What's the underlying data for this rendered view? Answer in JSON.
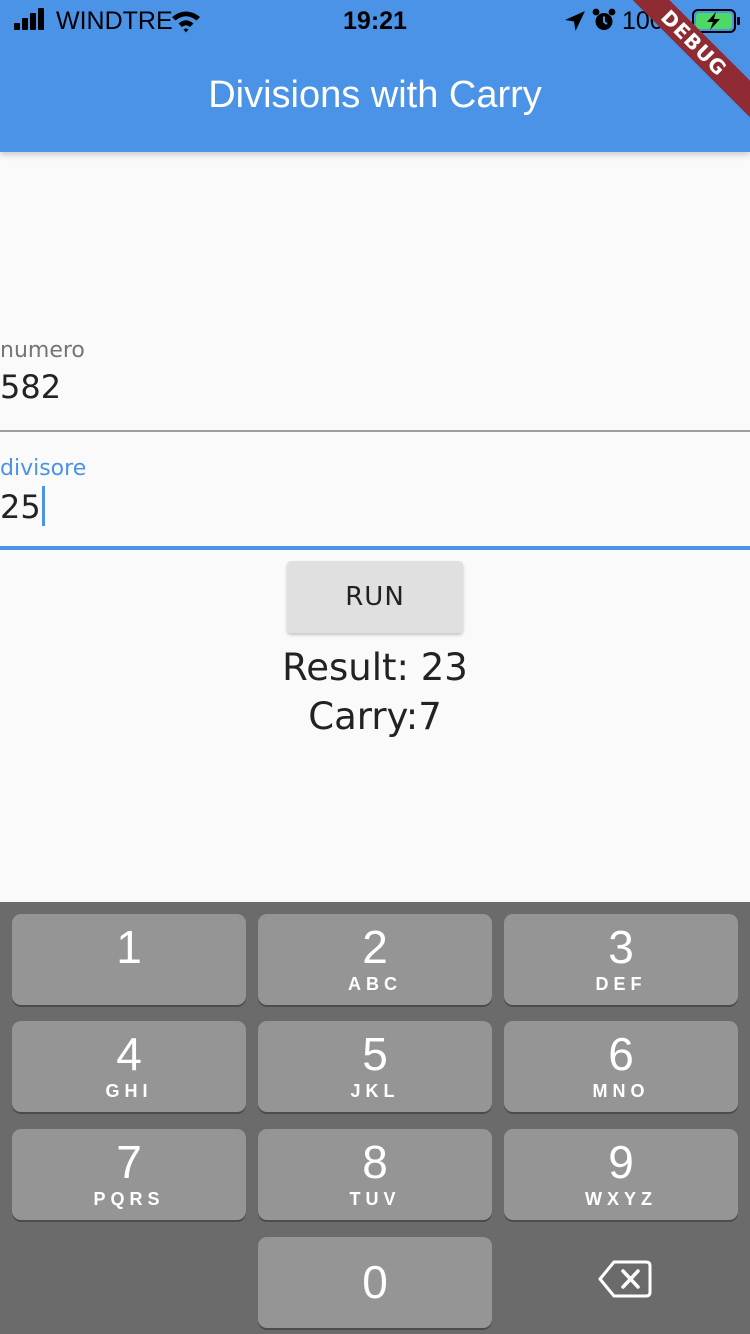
{
  "status_bar": {
    "carrier": "WINDTRE",
    "time": "19:21",
    "battery_percent": "100%"
  },
  "app_bar": {
    "title": "Divisions with Carry",
    "debug_banner": "DEBUG"
  },
  "form": {
    "numero": {
      "label": "numero",
      "value": "582"
    },
    "divisore": {
      "label": "divisore",
      "value": "25"
    }
  },
  "run_button": {
    "label": "RUN"
  },
  "output": {
    "result": "Result: 23",
    "carry": "Carry:7"
  },
  "keypad": {
    "keys": [
      {
        "digit": "1",
        "letters": ""
      },
      {
        "digit": "2",
        "letters": "ABC"
      },
      {
        "digit": "3",
        "letters": "DEF"
      },
      {
        "digit": "4",
        "letters": "GHI"
      },
      {
        "digit": "5",
        "letters": "JKL"
      },
      {
        "digit": "6",
        "letters": "MNO"
      },
      {
        "digit": "7",
        "letters": "PQRS"
      },
      {
        "digit": "8",
        "letters": "TUV"
      },
      {
        "digit": "9",
        "letters": "WXYZ"
      },
      {
        "digit": "0",
        "letters": ""
      }
    ]
  },
  "colors": {
    "accent": "#4a93e6",
    "debug_ribbon": "#8e2b33",
    "keypad_background": "#6b6b6b",
    "key": "#959595"
  }
}
